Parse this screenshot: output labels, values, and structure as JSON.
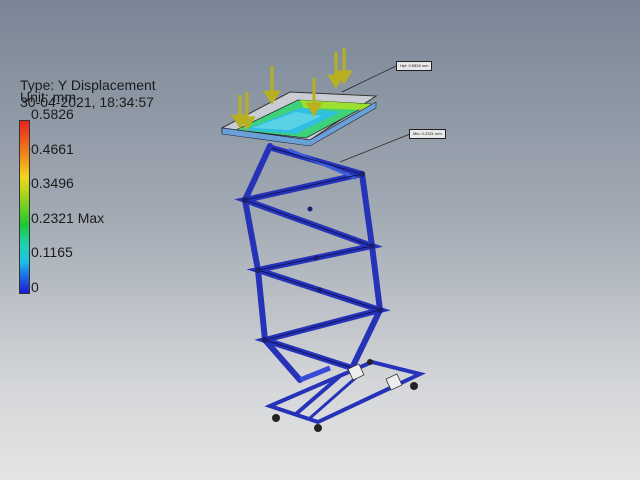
{
  "legend": {
    "type_label": "Type: Y Displacement",
    "unit_label": "Unit: mm",
    "date_label": "30-04-2021, 18:34:57",
    "ticks": [
      "0.5826",
      "0.4661",
      "0.3496",
      "0.2321 Max",
      "0.1165",
      "0"
    ]
  },
  "probes": {
    "upper": "Hpt: 0.5826 mm",
    "lower": "Min: 0.2321 mm"
  },
  "colors": {
    "frame_blue": "#2633b8",
    "arrow_yellow": "#b8b020"
  }
}
